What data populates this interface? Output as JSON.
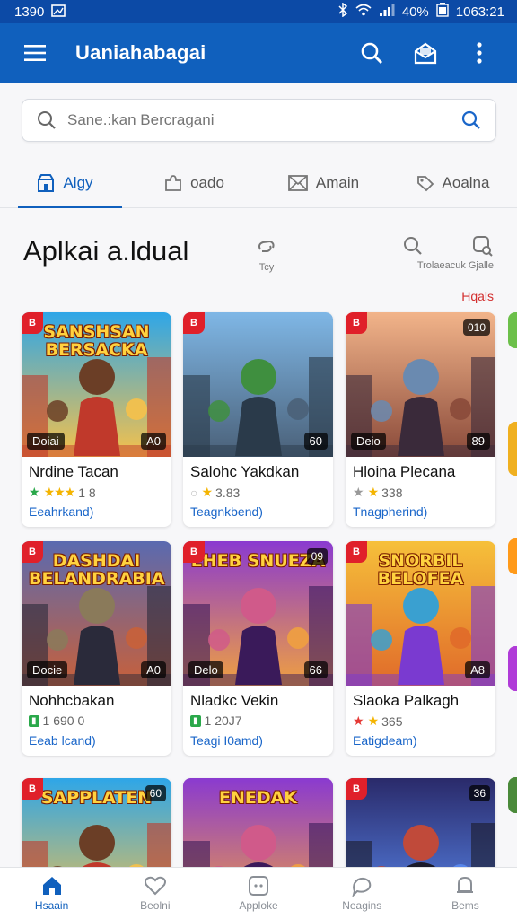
{
  "status": {
    "time": "1390",
    "battery": "40%",
    "clock": "1063:21"
  },
  "app_bar": {
    "title": "Uaniahabagai"
  },
  "search": {
    "placeholder": "Sane.:kan Bercragani"
  },
  "tabs": [
    {
      "label": "Algy",
      "icon": "store-icon",
      "active": true
    },
    {
      "label": "oado",
      "icon": "puzzle-icon",
      "active": false
    },
    {
      "label": "Amain",
      "icon": "mail-icon",
      "active": false
    },
    {
      "label": "Aoalna",
      "icon": "tag-icon",
      "active": false
    }
  ],
  "section": {
    "title": "Aplkai a.ldual",
    "tool_1": "Tcy",
    "tool_2": "Trolaeacuk Gjalle",
    "more": "Hqals"
  },
  "cards": [
    {
      "thumb_title": "SANSHSAN BERSACKA",
      "badge": "B",
      "label_left": "Doiai",
      "label_right": "A0",
      "label_top": "",
      "name": "Nrdine Tacan",
      "meta": "1 8",
      "meta_kind": "stars-green",
      "link": "Eeahrkand)",
      "palette": "sunset"
    },
    {
      "thumb_title": "",
      "badge": "B",
      "label_left": "",
      "label_right": "60",
      "label_top": "",
      "name": "Salohc Yakdkan",
      "meta": "3.83",
      "meta_kind": "stars-gold",
      "link": "Teagnkbend)",
      "palette": "city"
    },
    {
      "thumb_title": "",
      "badge": "B",
      "label_left": "Deio",
      "label_right": "89",
      "label_top": "010",
      "name": "Hloina Plecana",
      "meta": "338",
      "meta_kind": "stars-gray",
      "link": "Tnagpherind)",
      "palette": "tower"
    },
    {
      "thumb_title": "DASHDAI BELANDRABIA",
      "badge": "B",
      "label_left": "Docie",
      "label_right": "A0",
      "label_top": "",
      "name": "Nohhcbakan",
      "meta": "1 690 0",
      "meta_kind": "price-green",
      "link": "Eeab lcand)",
      "palette": "battle"
    },
    {
      "thumb_title": "EHEB SNUEZA",
      "badge": "B",
      "label_left": "Delo",
      "label_right": "66",
      "label_top": "09",
      "name": "Nladkc Vekin",
      "meta": "1 20J7",
      "meta_kind": "price-green",
      "link": "Teagi I0amd)",
      "palette": "purple"
    },
    {
      "thumb_title": "SNORBIL BELOFEA",
      "badge": "B",
      "label_left": "",
      "label_right": "A8",
      "label_top": "",
      "name": "Slaoka Palkagh",
      "meta": "365",
      "meta_kind": "stars-red",
      "link": "Eatigdeam)",
      "palette": "gold"
    },
    {
      "thumb_title": "SAPPLATEN",
      "badge": "B",
      "label_left": "",
      "label_right": "",
      "label_top": "60",
      "name": "",
      "meta": "",
      "meta_kind": "",
      "link": "",
      "palette": "sunset"
    },
    {
      "thumb_title": "ENEDAK",
      "badge": "",
      "label_left": "",
      "label_right": "",
      "label_top": "",
      "name": "",
      "meta": "",
      "meta_kind": "",
      "link": "",
      "palette": "purple"
    },
    {
      "thumb_title": "",
      "badge": "B",
      "label_left": "",
      "label_right": "",
      "label_top": "36",
      "name": "",
      "meta": "",
      "meta_kind": "",
      "link": "",
      "palette": "storm"
    }
  ],
  "bottom_nav": [
    {
      "label": "Hsaain",
      "icon": "home-icon",
      "active": true
    },
    {
      "label": "Beolni",
      "icon": "heart-icon",
      "active": false
    },
    {
      "label": "Apploke",
      "icon": "app-icon",
      "active": false
    },
    {
      "label": "Neagins",
      "icon": "chat-icon",
      "active": false
    },
    {
      "label": "Bems",
      "icon": "bell-icon",
      "active": false
    }
  ],
  "colors": {
    "primary": "#1060bd",
    "status_bar": "#0c4aa6",
    "accent_red": "#d32f2f",
    "rating_gold": "#f4b400",
    "rating_green": "#2aa84a"
  }
}
